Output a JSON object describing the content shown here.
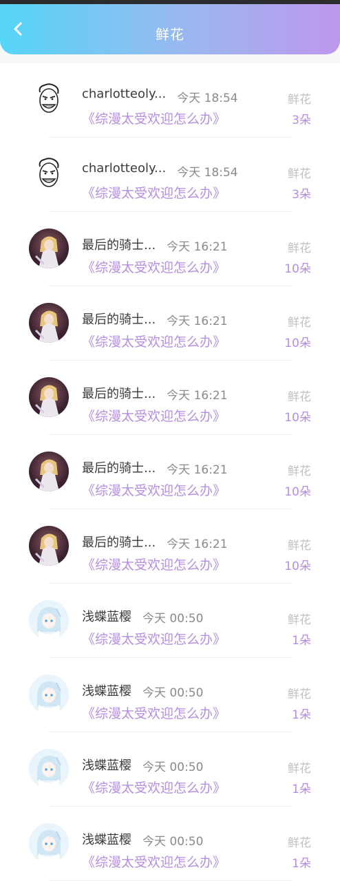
{
  "header": {
    "title": "鲜花",
    "back_icon": "back-chevron-icon"
  },
  "colors": {
    "accent": "#b48ee2",
    "header_start": "#55d6f7",
    "header_end": "#be97ec"
  },
  "items": [
    {
      "name": "charlotteoly...",
      "time": "今天 18:54",
      "gift": "鲜花",
      "book": "《综漫太受欢迎怎么办》",
      "count": "3朵",
      "avatar": "meme-face"
    },
    {
      "name": "charlotteoly...",
      "time": "今天 18:54",
      "gift": "鲜花",
      "book": "《综漫太受欢迎怎么办》",
      "count": "3朵",
      "avatar": "meme-face"
    },
    {
      "name": "最后的骑士...",
      "time": "今天 16:21",
      "gift": "鲜花",
      "book": "《综漫太受欢迎怎么办》",
      "count": "10朵",
      "avatar": "anime-dark"
    },
    {
      "name": "最后的骑士...",
      "time": "今天 16:21",
      "gift": "鲜花",
      "book": "《综漫太受欢迎怎么办》",
      "count": "10朵",
      "avatar": "anime-dark"
    },
    {
      "name": "最后的骑士...",
      "time": "今天 16:21",
      "gift": "鲜花",
      "book": "《综漫太受欢迎怎么办》",
      "count": "10朵",
      "avatar": "anime-dark"
    },
    {
      "name": "最后的骑士...",
      "time": "今天 16:21",
      "gift": "鲜花",
      "book": "《综漫太受欢迎怎么办》",
      "count": "10朵",
      "avatar": "anime-dark"
    },
    {
      "name": "最后的骑士...",
      "time": "今天 16:21",
      "gift": "鲜花",
      "book": "《综漫太受欢迎怎么办》",
      "count": "10朵",
      "avatar": "anime-dark"
    },
    {
      "name": "浅蝶蓝樱",
      "time": "今天 00:50",
      "gift": "鲜花",
      "book": "《综漫太受欢迎怎么办》",
      "count": "1朵",
      "avatar": "anime-light"
    },
    {
      "name": "浅蝶蓝樱",
      "time": "今天 00:50",
      "gift": "鲜花",
      "book": "《综漫太受欢迎怎么办》",
      "count": "1朵",
      "avatar": "anime-light"
    },
    {
      "name": "浅蝶蓝樱",
      "time": "今天 00:50",
      "gift": "鲜花",
      "book": "《综漫太受欢迎怎么办》",
      "count": "1朵",
      "avatar": "anime-light"
    },
    {
      "name": "浅蝶蓝樱",
      "time": "今天 00:50",
      "gift": "鲜花",
      "book": "《综漫太受欢迎怎么办》",
      "count": "1朵",
      "avatar": "anime-light"
    }
  ]
}
